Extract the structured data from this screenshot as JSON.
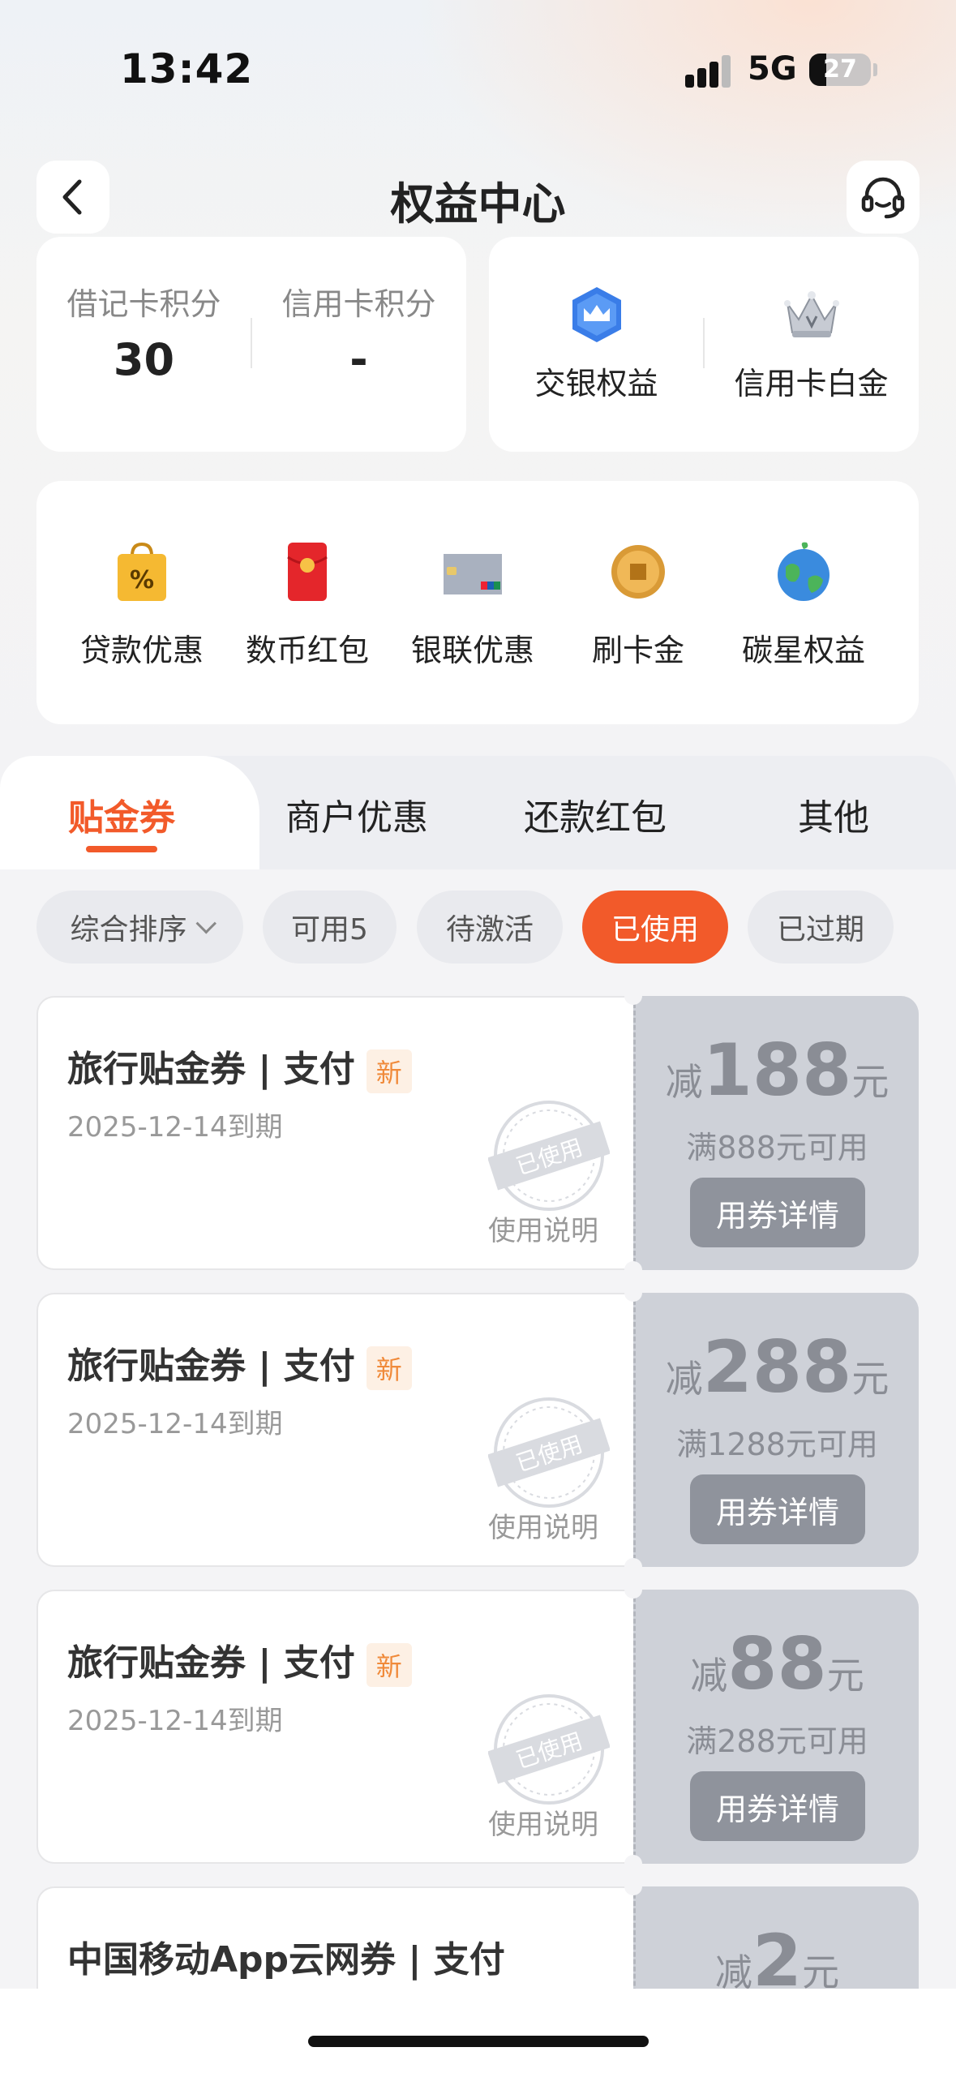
{
  "status_bar": {
    "time": "13:42",
    "network": "5G",
    "battery": "27",
    "battery_level": 0.27
  },
  "header": {
    "title": "权益中心"
  },
  "points": [
    {
      "label": "借记卡积分",
      "value": "30"
    },
    {
      "label": "信用卡积分",
      "value": "-"
    }
  ],
  "rights": [
    {
      "label": "交银权益",
      "icon": "crown-badge-icon"
    },
    {
      "label": "信用卡白金",
      "icon": "silver-crown-icon"
    }
  ],
  "features": [
    {
      "label": "贷款优惠",
      "icon": "shopping-bag-percent-icon"
    },
    {
      "label": "数币红包",
      "icon": "red-envelope-icon"
    },
    {
      "label": "银联优惠",
      "icon": "unionpay-card-icon"
    },
    {
      "label": "刷卡金",
      "icon": "gold-coin-icon"
    },
    {
      "label": "碳星权益",
      "icon": "earth-icon"
    }
  ],
  "tabs": [
    "贴金券",
    "商户优惠",
    "还款红包",
    "其他"
  ],
  "active_tab": "贴金券",
  "filters": [
    {
      "label": "综合排序",
      "selected": false
    },
    {
      "label": "可用5",
      "selected": false
    },
    {
      "label": "待激活",
      "selected": false
    },
    {
      "label": "已使用",
      "selected": true
    },
    {
      "label": "已过期",
      "selected": false
    }
  ],
  "colors": {
    "accent": "#f25a2a",
    "used_gray": "#ced1d8",
    "button_gray": "#8f939c"
  },
  "coupons": [
    {
      "title": "旅行贴金券 | 支付",
      "tag": "新",
      "expire": "2025-12-14到期",
      "instructions": "使用说明",
      "stamp": "已使用",
      "prefix": "减",
      "amount": "188",
      "unit": "元",
      "condition": "满888元可用",
      "button": "用券详情"
    },
    {
      "title": "旅行贴金券 | 支付",
      "tag": "新",
      "expire": "2025-12-14到期",
      "instructions": "使用说明",
      "stamp": "已使用",
      "prefix": "减",
      "amount": "288",
      "unit": "元",
      "condition": "满1288元可用",
      "button": "用券详情"
    },
    {
      "title": "旅行贴金券 | 支付",
      "tag": "新",
      "expire": "2025-12-14到期",
      "instructions": "使用说明",
      "stamp": "已使用",
      "prefix": "减",
      "amount": "88",
      "unit": "元",
      "condition": "满288元可用",
      "button": "用券详情"
    },
    {
      "title": "中国移动App云网券 | 支付",
      "prefix": "减",
      "amount": "2",
      "unit": "元"
    }
  ]
}
